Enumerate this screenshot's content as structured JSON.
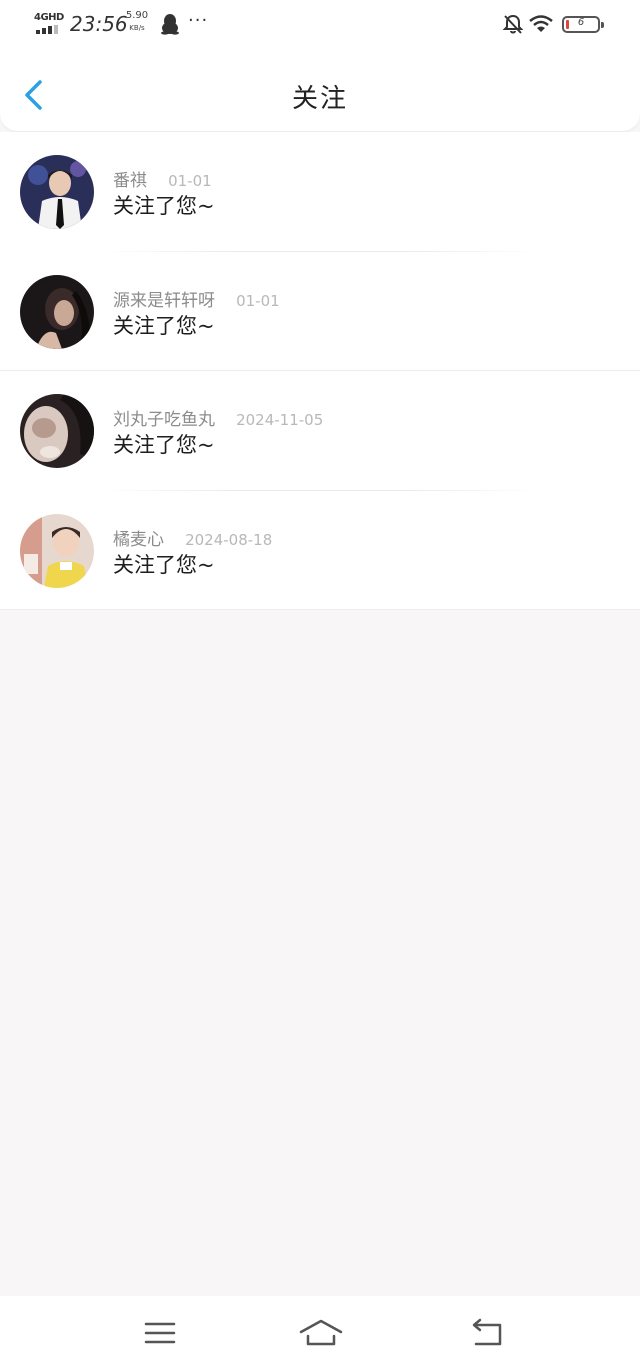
{
  "status_bar": {
    "network": "4GHD",
    "time": "23:56",
    "speed_value": "5.90",
    "speed_unit": "KB/s",
    "more": "···",
    "battery_level": "6"
  },
  "header": {
    "title": "关注",
    "back_icon": "chevron-left-icon",
    "accent_color": "#2d9fe3"
  },
  "notifications": [
    {
      "name": "番祺",
      "date": "01-01",
      "message": "关注了您~"
    },
    {
      "name": "源来是轩轩呀",
      "date": "01-01",
      "message": "关注了您~"
    },
    {
      "name": "刘丸子吃鱼丸",
      "date": "2024-11-05",
      "message": "关注了您~"
    },
    {
      "name": "橘麦心",
      "date": "2024-08-18",
      "message": "关注了您~"
    }
  ],
  "nav_bar": {
    "menu_icon": "menu-icon",
    "home_icon": "home-icon",
    "back_icon": "back-arrow-icon"
  },
  "colors": {
    "page_background": "#f8f6f7",
    "card_background": "#ffffff",
    "name_color": "#8c8c8c",
    "date_color": "#b8b8b8"
  }
}
